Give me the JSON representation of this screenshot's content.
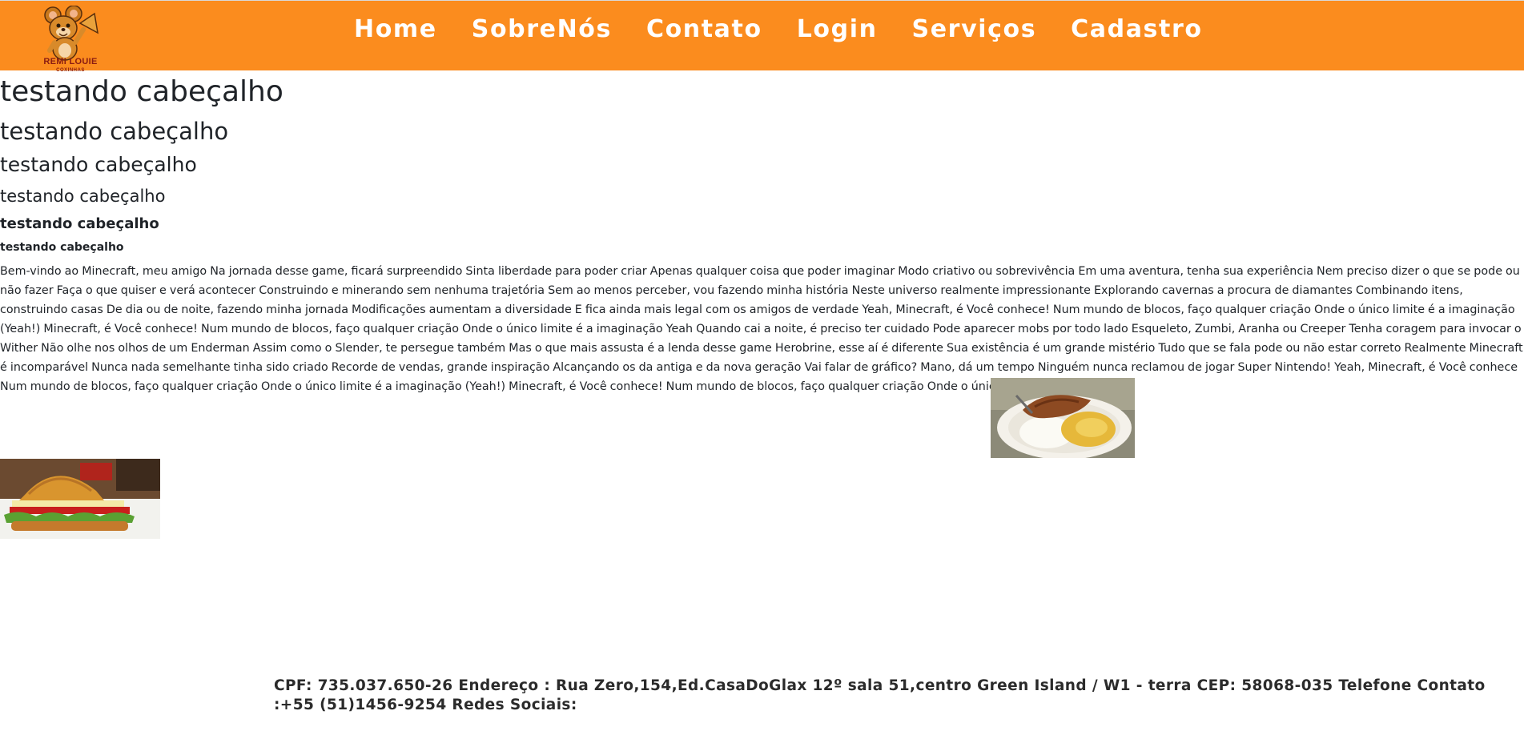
{
  "brand": {
    "name": "REMI LOUIE",
    "tagline": "COXINHAS"
  },
  "nav": {
    "items": [
      {
        "label": "Home"
      },
      {
        "label": "SobreNós"
      },
      {
        "label": "Contato"
      },
      {
        "label": "Login"
      },
      {
        "label": "Serviços"
      },
      {
        "label": "Cadastro"
      }
    ]
  },
  "headings": {
    "h1": "testando cabeçalho",
    "h2": "testando cabeçalho",
    "h3": "testando cabeçalho",
    "h4": "testando cabeçalho",
    "h5": "testando cabeçalho",
    "h6": "testando cabeçalho"
  },
  "body_text": "Bem-vindo ao Minecraft, meu amigo Na jornada desse game, ficará surpreendido Sinta liberdade para poder criar Apenas qualquer coisa que poder imaginar Modo criativo ou sobrevivência Em uma aventura, tenha sua experiência Nem preciso dizer o que se pode ou não fazer Faça o que quiser e verá acontecer Construindo e minerando sem nenhuma trajetória Sem ao menos perceber, vou fazendo minha história Neste universo realmente impressionante Explorando cavernas a procura de diamantes Combinando itens, construindo casas De dia ou de noite, fazendo minha jornada Modificações aumentam a diversidade E fica ainda mais legal com os amigos de verdade Yeah, Minecraft, é Você conhece! Num mundo de blocos, faço qualquer criação Onde o único limite é a imaginação (Yeah!) Minecraft, é Você conhece! Num mundo de blocos, faço qualquer criação Onde o único limite é a imaginação Yeah Quando cai a noite, é preciso ter cuidado Pode aparecer mobs por todo lado Esqueleto, Zumbi, Aranha ou Creeper Tenha coragem para invocar o Wither Não olhe nos olhos de um Enderman Assim como o Slender, te persegue também Mas o que mais assusta é a lenda desse game Herobrine, esse aí é diferente Sua existência é um grande mistério Tudo que se fala pode ou não estar correto Realmente Minecraft é incomparável Nunca nada semelhante tinha sido criado Recorde de vendas, grande inspiração Alcançando os da antiga e da nova geração Vai falar de gráfico? Mano, dá um tempo Ninguém nunca reclamou de jogar Super Nintendo! Yeah, Minecraft, é Você conhece Num mundo de blocos, faço qualquer criação Onde o único limite é a imaginação (Yeah!) Minecraft, é Você conhece! Num mundo de blocos, faço qualquer criação Onde o único limite é a imaginação",
  "footer": {
    "text": "CPF: 735.037.650-26 Endereço : Rua Zero,154,Ed.CasaDoGlax 12º sala 51,centro Green Island / W1 - terra CEP: 58068-035 Telefone Contato :+55 (51)1456-9254 Redes Sociais:"
  },
  "colors": {
    "navbar": "#fb8c1e",
    "nav_text": "#ffffff",
    "logo_text": "#8a1c12"
  }
}
